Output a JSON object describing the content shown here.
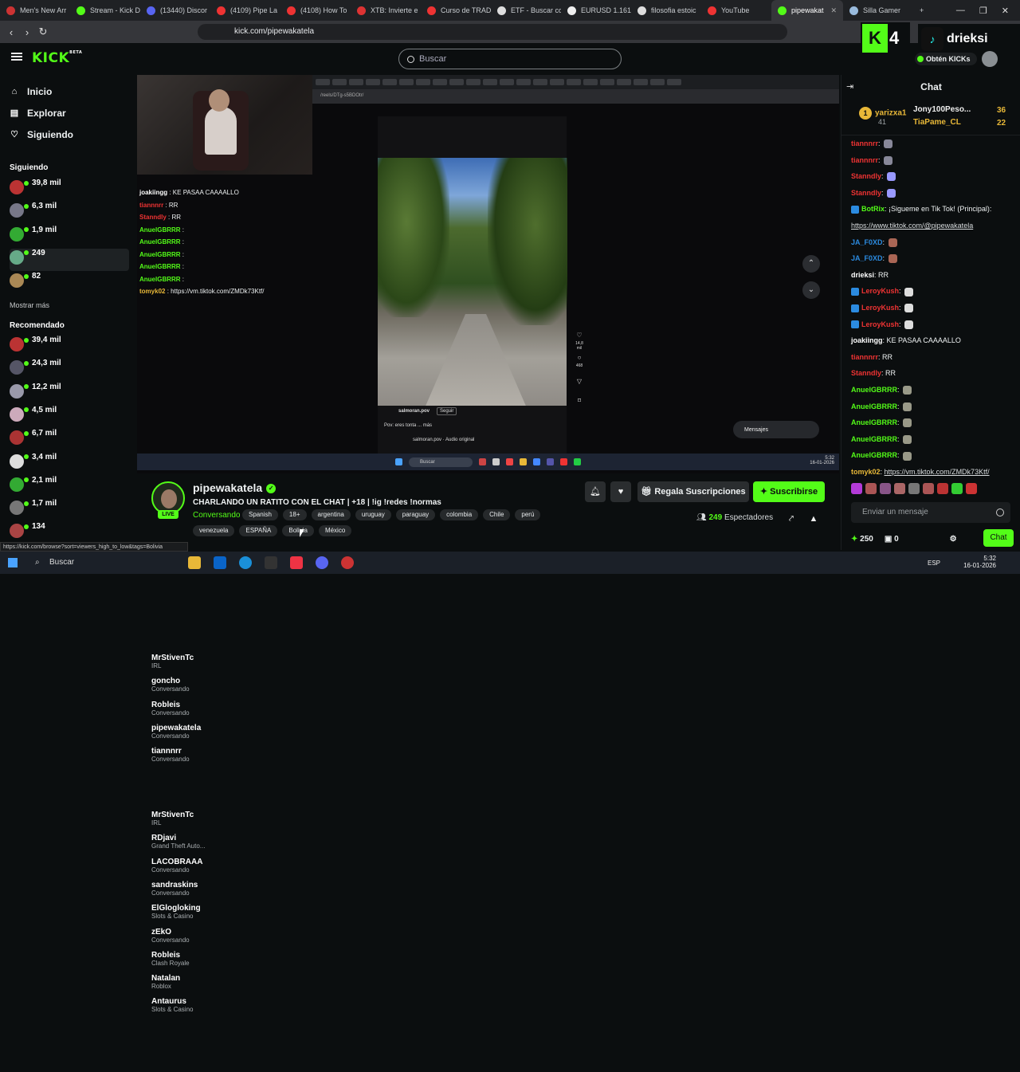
{
  "browser": {
    "tabs": [
      {
        "label": "Men's New Arr",
        "color": "#c33"
      },
      {
        "label": "Stream - Kick D",
        "color": "#53fc18"
      },
      {
        "label": "(13440) Discor",
        "color": "#5865f2"
      },
      {
        "label": "(4109) Pipe La",
        "color": "#e33"
      },
      {
        "label": "(4108) How To",
        "color": "#e33"
      },
      {
        "label": "XTB: Invierte e",
        "color": "#d33"
      },
      {
        "label": "Curso de TRAD",
        "color": "#e33"
      },
      {
        "label": "ETF - Buscar co",
        "color": "#ddd"
      },
      {
        "label": "EURUSD 1.161",
        "color": "#eee"
      },
      {
        "label": "filosofia estoic",
        "color": "#ddd"
      },
      {
        "label": "YouTube",
        "color": "#e33"
      },
      {
        "label": "pipewakat",
        "color": "#53fc18",
        "active": true
      },
      {
        "label": "Silla Gamer",
        "color": "#9bd"
      }
    ],
    "url": "kick.com/pipewakatela"
  },
  "header": {
    "logo": "KICK",
    "logo_sup": "BETA",
    "search_placeholder": "Buscar"
  },
  "overlay": {
    "kick_count": "4",
    "tiktok_name": "drieksi",
    "obten_kicks": "Obtén KICKs"
  },
  "nav": [
    {
      "label": "Inicio",
      "icon": "home-icon"
    },
    {
      "label": "Explorar",
      "icon": "explore-icon"
    },
    {
      "label": "Siguiendo",
      "icon": "heart-icon"
    }
  ],
  "following_title": "Siguiendo",
  "following": [
    {
      "name": "MrStivenTc",
      "category": "IRL",
      "viewers": "39,8 mil",
      "color": "#b33"
    },
    {
      "name": "goncho",
      "category": "Conversando",
      "viewers": "6,3 mil",
      "color": "#778"
    },
    {
      "name": "Robleis",
      "category": "Conversando",
      "viewers": "1,9 mil",
      "color": "#3a3"
    },
    {
      "name": "pipewakatela",
      "category": "Conversando",
      "viewers": "249",
      "color": "#6a8"
    },
    {
      "name": "tiannnrr",
      "category": "Conversando",
      "viewers": "82",
      "color": "#a85"
    }
  ],
  "show_more": "Mostrar más",
  "recommended_title": "Recomendado",
  "recommended": [
    {
      "name": "MrStivenTc",
      "category": "IRL",
      "viewers": "39,4 mil",
      "color": "#b33"
    },
    {
      "name": "RDjavi",
      "category": "Grand Theft Auto...",
      "viewers": "24,3 mil",
      "color": "#556"
    },
    {
      "name": "LACOBRAAA",
      "category": "Conversando",
      "viewers": "12,2 mil",
      "color": "#99a"
    },
    {
      "name": "sandraskins",
      "category": "Conversando",
      "viewers": "4,5 mil",
      "color": "#cab"
    },
    {
      "name": "ElGlogloking",
      "category": "Slots & Casino",
      "viewers": "6,7 mil",
      "color": "#a33"
    },
    {
      "name": "zEkO",
      "category": "Conversando",
      "viewers": "3,4 mil",
      "color": "#ddd"
    },
    {
      "name": "Robleis",
      "category": "Clash Royale",
      "viewers": "2,1 mil",
      "color": "#3a3"
    },
    {
      "name": "Natalan",
      "category": "Roblox",
      "viewers": "1,7 mil",
      "color": "#777"
    },
    {
      "name": "Antaurus",
      "category": "Slots & Casino",
      "viewers": "134",
      "color": "#a44"
    }
  ],
  "stream_chat_overlay": [
    {
      "user": "joakiingg",
      "text": "KE PASAA CAAAALLO",
      "color": "#fff"
    },
    {
      "user": "tiannnrr",
      "text": "RR",
      "color": "#e33"
    },
    {
      "user": "Stanndly",
      "text": "RR",
      "color": "#e33"
    },
    {
      "user": "AnuelGBRRR",
      "text": "",
      "color": "#53fc18"
    },
    {
      "user": "AnuelGBRRR",
      "text": "",
      "color": "#53fc18"
    },
    {
      "user": "AnuelGBRRR",
      "text": "",
      "color": "#53fc18"
    },
    {
      "user": "AnuelGBRRR",
      "text": "",
      "color": "#53fc18"
    },
    {
      "user": "AnuelGBRRR",
      "text": "",
      "color": "#53fc18"
    },
    {
      "user": "tomyk02",
      "text": "https://vm.tiktok.com/ZMDk73Ktf/",
      "color": "#e8b838"
    }
  ],
  "video": {
    "url": "/reels/DTg-s5BDOtr/",
    "tiktok_user": "salmoran.pov",
    "follow": "Seguir",
    "caption": "Pov: eres tonta ... más",
    "audio": "salmoran.pov · Audio original",
    "likes": "14,8 mil",
    "comments": "468",
    "mensajes": "Mensajes",
    "win_search": "Buscar",
    "time": "5:32",
    "date": "16-01-2026"
  },
  "chat": {
    "title": "Chat",
    "pinned": [
      {
        "name": "yarizxa1",
        "count": "41",
        "color": "#e8b838"
      },
      {
        "name": "Jony100Peso...",
        "count": "36",
        "color": "#eee"
      },
      {
        "name": "TiaPame_CL",
        "count": "22",
        "color": "#e8b838"
      }
    ],
    "messages": [
      {
        "user": "tiannnrr",
        "text": "",
        "color": "#e33",
        "emote": "#889"
      },
      {
        "user": "tiannnrr",
        "text": "",
        "color": "#e33",
        "emote": "#889"
      },
      {
        "user": "Stanndly",
        "text": "",
        "color": "#e33",
        "emote": "#99f"
      },
      {
        "user": "Stanndly",
        "text": "",
        "color": "#e33",
        "emote": "#99f"
      },
      {
        "user": "BotRix",
        "text": "¡Sigueme en Tik Tok! (Principal):",
        "color": "#53fc18",
        "badge": true
      },
      {
        "user": "",
        "text": "https://www.tiktok.com/@pipewakatela",
        "color": "#fff",
        "link": true
      },
      {
        "user": "JA_F0XD",
        "text": "",
        "color": "#2b8be0",
        "emote": "#a65"
      },
      {
        "user": "JA_F0XD",
        "text": "",
        "color": "#2b8be0",
        "emote": "#a65"
      },
      {
        "user": "drieksi",
        "text": "RR",
        "color": "#fff"
      },
      {
        "user": "LeroyKush",
        "text": "",
        "color": "#e33",
        "emote": "#ddd",
        "badge": true
      },
      {
        "user": "LeroyKush",
        "text": "",
        "color": "#e33",
        "emote": "#ddd",
        "badge": true
      },
      {
        "user": "LeroyKush",
        "text": "",
        "color": "#e33",
        "emote": "#ddd",
        "badge": true
      },
      {
        "user": "joakiingg",
        "text": "KE PASAA CAAAALLO",
        "color": "#fff"
      },
      {
        "user": "tiannnrr",
        "text": "RR",
        "color": "#e33"
      },
      {
        "user": "Stanndly",
        "text": "RR",
        "color": "#e33"
      },
      {
        "user": "AnuelGBRRR",
        "text": "",
        "color": "#53fc18",
        "emote": "#998"
      },
      {
        "user": "AnuelGBRRR",
        "text": "",
        "color": "#53fc18",
        "emote": "#998"
      },
      {
        "user": "AnuelGBRRR",
        "text": "",
        "color": "#53fc18",
        "emote": "#998"
      },
      {
        "user": "AnuelGBRRR",
        "text": "",
        "color": "#53fc18",
        "emote": "#998"
      },
      {
        "user": "AnuelGBRRR",
        "text": "",
        "color": "#53fc18",
        "emote": "#998"
      },
      {
        "user": "tomyk02",
        "text": "https://vm.tiktok.com/ZMDk73Ktf/",
        "color": "#e8b838",
        "link": true
      }
    ],
    "input_placeholder": "Enviar un mensaje",
    "kicks": "250",
    "gifts": "0",
    "send_label": "Chat"
  },
  "stream": {
    "name": "pipewakatela",
    "title": "CHARLANDO UN RATITO CON EL CHAT | +18 | !ig !redes !normas",
    "category": "Conversando",
    "live": "LIVE",
    "tags_row1": [
      "Spanish",
      "18+",
      "argentina",
      "uruguay",
      "paraguay",
      "colombia",
      "Chile",
      "perú"
    ],
    "tags_row2": [
      "venezuela",
      "ESPAÑA",
      "Bolivia",
      "México"
    ],
    "gift_subs": "Regala Suscripciones",
    "subscribe": "Suscribirse",
    "viewers": "249",
    "viewers_label": "Espectadores"
  },
  "status_url": "https://kick.com/browse?sort=viewers_high_to_low&tags=Bolivia",
  "taskbar": {
    "search": "Buscar",
    "lang": "ESP",
    "time": "5:32",
    "date": "16-01-2026"
  }
}
